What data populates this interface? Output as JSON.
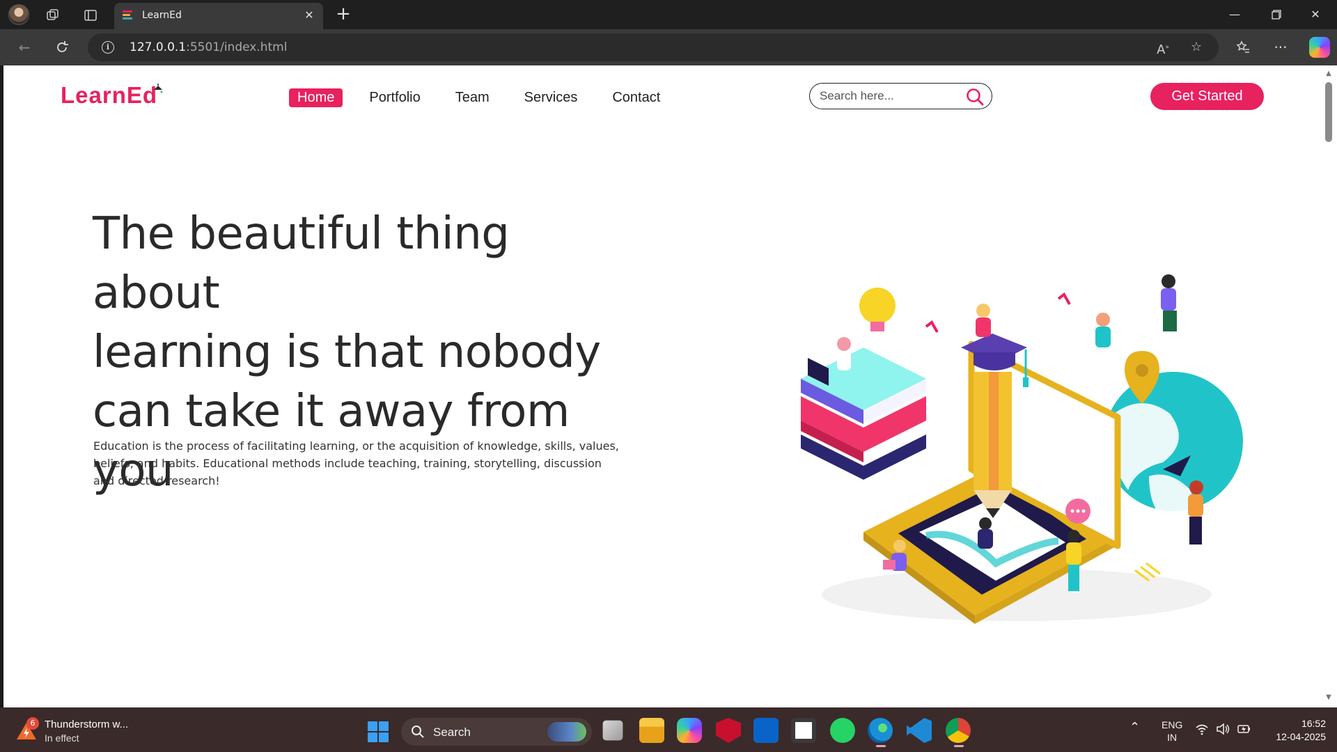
{
  "browser": {
    "tab_title": "LearnEd",
    "url_host": "127.0.0.1",
    "url_rest": ":5501/index.html"
  },
  "site": {
    "logo_main": "Learn",
    "logo_accent": "Ed",
    "nav": [
      {
        "label": "Home",
        "active": true
      },
      {
        "label": "Portfolio",
        "active": false
      },
      {
        "label": "Team",
        "active": false
      },
      {
        "label": "Services",
        "active": false
      },
      {
        "label": "Contact",
        "active": false
      }
    ],
    "search_placeholder": "Search here...",
    "cta_label": "Get Started",
    "accent_color": "#e8215f"
  },
  "hero": {
    "title_line1": "The beautiful thing about",
    "title_line2": "learning is that nobody",
    "title_line3": "can take it away from you",
    "body": "Education is the process of facilitating learning, or the acquisition of knowledge, skills, values, beliefs, and habits. Educational methods include teaching, training, storytelling, discussion and directed research!"
  },
  "taskbar": {
    "weather_title": "Thunderstorm w...",
    "weather_sub": "In effect",
    "weather_badge": "6",
    "search_label": "Search",
    "lang_top": "ENG",
    "lang_bottom": "IN",
    "time": "16:52",
    "date": "12-04-2025"
  }
}
